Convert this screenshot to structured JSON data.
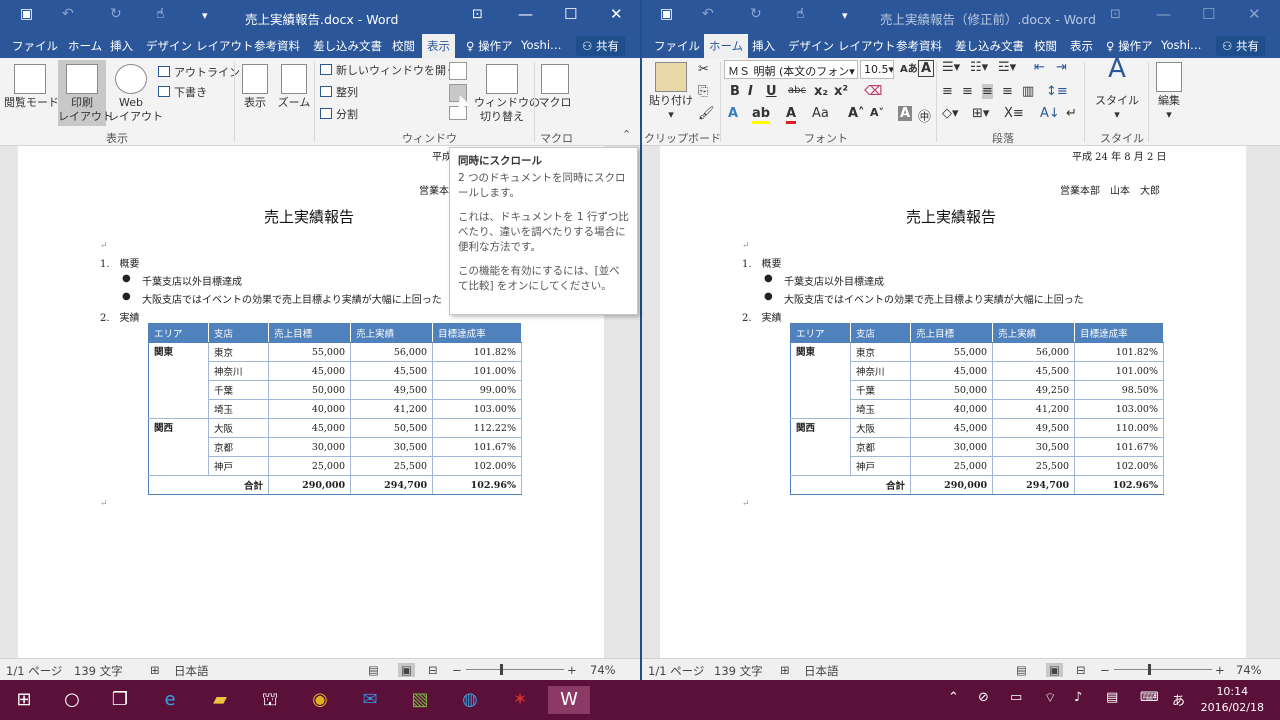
{
  "colors": {
    "word_blue": "#2b579a",
    "table_header": "#4f81bd",
    "taskbar": "#5a1038"
  },
  "left": {
    "title": "売上実績報告.docx - Word",
    "tabs": [
      "ファイル",
      "ホーム",
      "挿入",
      "デザイン",
      "レイアウト",
      "参考資料",
      "差し込み文書",
      "校閲",
      "表示",
      "操作ア",
      "Yoshi…"
    ],
    "share": "共有",
    "ribbon": {
      "read_mode": "閲覧モード",
      "print_layout_1": "印刷",
      "print_layout_2": "レイアウト",
      "web_layout_1": "Web",
      "web_layout_2": "レイアウト",
      "outline": "アウトライン",
      "draft": "下書き",
      "group_view": "表示",
      "show": "表示",
      "zoom": "ズーム",
      "new_window": "新しいウィンドウを開く",
      "arrange": "整列",
      "split": "分割",
      "switch_window_1": "ウィンドウの",
      "switch_window_2": "切り替え",
      "group_window": "ウィンドウ",
      "macro": "マクロ",
      "group_macro": "マクロ"
    },
    "doc": {
      "date_partial": "平成",
      "dept_partial": "営業本",
      "heading": "売上実績報告",
      "item1": "1.　概要",
      "bullet1": "千葉支店以外目標達成",
      "bullet2": "大阪支店ではイベントの効果で売上目標より実績が大幅に上回った",
      "item2": "2.　実績"
    },
    "table": {
      "headers": [
        "エリア",
        "支店",
        "売上目標",
        "売上実績",
        "目標達成率"
      ],
      "rows": [
        [
          "関東",
          "東京",
          "55,000",
          "56,000",
          "101.82%"
        ],
        [
          "",
          "神奈川",
          "45,000",
          "45,500",
          "101.00%"
        ],
        [
          "",
          "千葉",
          "50,000",
          "49,500",
          "99.00%"
        ],
        [
          "",
          "埼玉",
          "40,000",
          "41,200",
          "103.00%"
        ],
        [
          "関西",
          "大阪",
          "45,000",
          "50,500",
          "112.22%"
        ],
        [
          "",
          "京都",
          "30,000",
          "30,500",
          "101.67%"
        ],
        [
          "",
          "神戸",
          "25,000",
          "25,500",
          "102.00%"
        ]
      ],
      "total": [
        "合計",
        "290,000",
        "294,700",
        "102.96%"
      ]
    },
    "status": {
      "page": "1/1 ページ",
      "words": "139 文字",
      "lang": "日本語",
      "zoom": "74%"
    }
  },
  "tooltip": {
    "title": "同時にスクロール",
    "p1": "2 つのドキュメントを同時にスクロールします。",
    "p2": "これは、ドキュメントを 1 行ずつ比べたり、違いを調べたりする場合に便利な方法です。",
    "p3": "この機能を有効にするには、[並べて比較] をオンにしてください。"
  },
  "right": {
    "title": "売上実績報告（修正前）.docx - Word",
    "tabs": [
      "ファイル",
      "ホーム",
      "挿入",
      "デザイン",
      "レイアウト",
      "参考資料",
      "差し込み文書",
      "校閲",
      "表示",
      "操作ア",
      "Yoshi…"
    ],
    "share": "共有",
    "ribbon": {
      "paste": "貼り付け",
      "group_clipboard": "クリップボード",
      "font_name": "ＭＳ 明朝 (本文のフォン",
      "font_size": "10.5",
      "group_font": "フォント",
      "group_paragraph": "段落",
      "style": "スタイル",
      "group_style": "スタイル",
      "edit": "編集"
    },
    "doc": {
      "date": "平成 24 年 8 月 2 日",
      "dept": "営業本部　山本　大郎",
      "heading": "売上実績報告",
      "item1": "1.　概要",
      "bullet1": "千葉支店以外目標達成",
      "bullet2": "大阪支店ではイベントの効果で売上目標より実績が大幅に上回った",
      "item2": "2.　実績"
    },
    "table": {
      "headers": [
        "エリア",
        "支店",
        "売上目標",
        "売上実績",
        "目標達成率"
      ],
      "rows": [
        [
          "関東",
          "東京",
          "55,000",
          "56,000",
          "101.82%"
        ],
        [
          "",
          "神奈川",
          "45,000",
          "45,500",
          "101.00%"
        ],
        [
          "",
          "千葉",
          "50,000",
          "49,250",
          "98.50%"
        ],
        [
          "",
          "埼玉",
          "40,000",
          "41,200",
          "103.00%"
        ],
        [
          "関西",
          "大阪",
          "45,000",
          "49,500",
          "110.00%"
        ],
        [
          "",
          "京都",
          "30,000",
          "30,500",
          "101.67%"
        ],
        [
          "",
          "神戸",
          "25,000",
          "25,500",
          "102.00%"
        ]
      ],
      "total": [
        "合計",
        "290,000",
        "294,700",
        "102.96%"
      ]
    },
    "status": {
      "page": "1/1 ページ",
      "words": "139 文字",
      "lang": "日本語",
      "zoom": "74%"
    }
  },
  "taskbar": {
    "ime": "あ",
    "time": "10:14",
    "date": "2016/02/18"
  }
}
